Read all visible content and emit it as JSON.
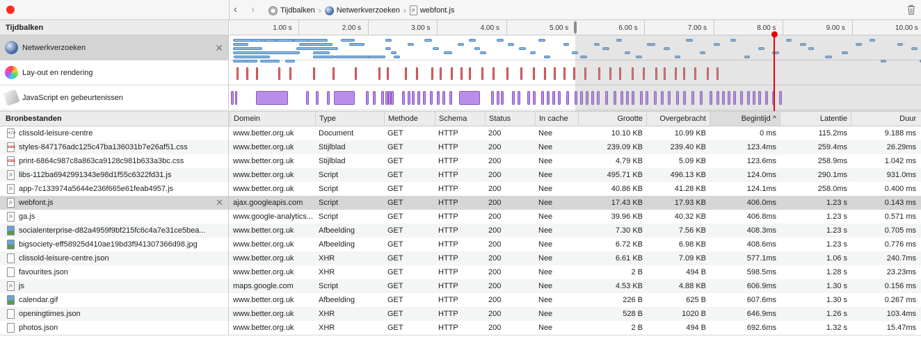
{
  "toolbar": {
    "record_icon": "record-icon",
    "back_icon": "‹",
    "forward_icon": "›",
    "breadcrumbs": [
      {
        "icon": "timelines-icon",
        "label": "Tijdbalken"
      },
      {
        "icon": "network-globe-icon",
        "label": "Netwerkverzoeken"
      },
      {
        "icon": "js-file-icon",
        "label": "webfont.js"
      }
    ],
    "trash_icon": "trash-icon"
  },
  "timelines": {
    "header": "Tijdbalken",
    "rows": [
      {
        "label": "Netwerkverzoeken",
        "icon": "network-globe-icon",
        "selected": true,
        "close": "✕"
      },
      {
        "label": "Lay-out en rendering",
        "icon": "layout-rendering-icon",
        "selected": false
      },
      {
        "label": "JavaScript en gebeurtenissen",
        "icon": "javascript-events-icon",
        "selected": false
      }
    ],
    "ruler_ticks": [
      "1.00 s",
      "2.00 s",
      "3.00 s",
      "4.00 s",
      "5.00 s",
      "6.00 s",
      "7.00 s",
      "8.00 s",
      "9.00 s",
      "10.00 s"
    ],
    "visible_range_s": [
      0,
      10.0
    ],
    "selection_s": [
      5.0,
      10.0
    ],
    "playhead_s": 7.88,
    "colors": {
      "network": "#8ab6dc",
      "layout": "#e6787a",
      "javascript": "#b98ee8",
      "playhead": "#e0000f"
    }
  },
  "table": {
    "source_header": "Bronbestanden",
    "columns": [
      "Domein",
      "Type",
      "Methode",
      "Schema",
      "Status",
      "In cache",
      "Grootte",
      "Overgebracht",
      "Begintijd",
      "Latentie",
      "Duur"
    ],
    "sorted_column": "Begintijd",
    "sort_indicator": "^",
    "row_close": "✕",
    "rows": [
      {
        "name": "clissold-leisure-centre",
        "icon": "document",
        "domain": "www.better.org.uk",
        "type": "Document",
        "method": "GET",
        "scheme": "HTTP",
        "status": "200",
        "cached": "Nee",
        "size": "10.10 KB",
        "transferred": "10.99 KB",
        "start": "0 ms",
        "latency": "115.2ms",
        "duration": "9.188 ms"
      },
      {
        "name": "styles-847176adc125c47ba136031b7e26af51.css",
        "icon": "css",
        "domain": "www.better.org.uk",
        "type": "Stijlblad",
        "method": "GET",
        "scheme": "HTTP",
        "status": "200",
        "cached": "Nee",
        "size": "239.09 KB",
        "transferred": "239.40 KB",
        "start": "123.4ms",
        "latency": "259.4ms",
        "duration": "26.29ms"
      },
      {
        "name": "print-6864c987c8a863ca9128c981b633a3bc.css",
        "icon": "css",
        "domain": "www.better.org.uk",
        "type": "Stijlblad",
        "method": "GET",
        "scheme": "HTTP",
        "status": "200",
        "cached": "Nee",
        "size": "4.79 KB",
        "transferred": "5.09 KB",
        "start": "123.6ms",
        "latency": "258.9ms",
        "duration": "1.042 ms"
      },
      {
        "name": "libs-112ba6942991343e98d1f55c6322fd31.js",
        "icon": "js",
        "domain": "www.better.org.uk",
        "type": "Script",
        "method": "GET",
        "scheme": "HTTP",
        "status": "200",
        "cached": "Nee",
        "size": "495.71 KB",
        "transferred": "496.13 KB",
        "start": "124.0ms",
        "latency": "290.1ms",
        "duration": "931.0ms"
      },
      {
        "name": "app-7c133974a5644e236f665e61feab4957.js",
        "icon": "js",
        "domain": "www.better.org.uk",
        "type": "Script",
        "method": "GET",
        "scheme": "HTTP",
        "status": "200",
        "cached": "Nee",
        "size": "40.86 KB",
        "transferred": "41.28 KB",
        "start": "124.1ms",
        "latency": "258.0ms",
        "duration": "0.400 ms"
      },
      {
        "name": "webfont.js",
        "icon": "js",
        "selected": true,
        "domain": "ajax.googleapis.com",
        "type": "Script",
        "method": "GET",
        "scheme": "HTTP",
        "status": "200",
        "cached": "Nee",
        "size": "17.43 KB",
        "transferred": "17.93 KB",
        "start": "406.0ms",
        "latency": "1.23 s",
        "duration": "0.143 ms"
      },
      {
        "name": "ga.js",
        "icon": "js",
        "domain": "www.google-analytics...",
        "type": "Script",
        "method": "GET",
        "scheme": "HTTP",
        "status": "200",
        "cached": "Nee",
        "size": "39.96 KB",
        "transferred": "40.32 KB",
        "start": "406.8ms",
        "latency": "1.23 s",
        "duration": "0.571 ms"
      },
      {
        "name": "socialenterprise-d82a4959f9bf215fc6c4a7e31ce5bea...",
        "icon": "img",
        "domain": "www.better.org.uk",
        "type": "Afbeelding",
        "method": "GET",
        "scheme": "HTTP",
        "status": "200",
        "cached": "Nee",
        "size": "7.30 KB",
        "transferred": "7.56 KB",
        "start": "408.3ms",
        "latency": "1.23 s",
        "duration": "0.705 ms"
      },
      {
        "name": "bigsociety-eff58925d410ae19bd3f941307366d98.jpg",
        "icon": "img",
        "domain": "www.better.org.uk",
        "type": "Afbeelding",
        "method": "GET",
        "scheme": "HTTP",
        "status": "200",
        "cached": "Nee",
        "size": "6.72 KB",
        "transferred": "6.98 KB",
        "start": "408.6ms",
        "latency": "1.23 s",
        "duration": "0.776 ms"
      },
      {
        "name": "clissold-leisure-centre.json",
        "icon": "blank",
        "domain": "www.better.org.uk",
        "type": "XHR",
        "method": "GET",
        "scheme": "HTTP",
        "status": "200",
        "cached": "Nee",
        "size": "6.61 KB",
        "transferred": "7.09 KB",
        "start": "577.1ms",
        "latency": "1.06 s",
        "duration": "240.7ms"
      },
      {
        "name": "favourites.json",
        "icon": "blank",
        "domain": "www.better.org.uk",
        "type": "XHR",
        "method": "GET",
        "scheme": "HTTP",
        "status": "200",
        "cached": "Nee",
        "size": "2 B",
        "transferred": "494 B",
        "start": "598.5ms",
        "latency": "1.28 s",
        "duration": "23.23ms"
      },
      {
        "name": "js",
        "icon": "js",
        "domain": "maps.google.com",
        "type": "Script",
        "method": "GET",
        "scheme": "HTTP",
        "status": "200",
        "cached": "Nee",
        "size": "4.53 KB",
        "transferred": "4.88 KB",
        "start": "606.9ms",
        "latency": "1.30 s",
        "duration": "0.156 ms"
      },
      {
        "name": "calendar.gif",
        "icon": "img",
        "domain": "www.better.org.uk",
        "type": "Afbeelding",
        "method": "GET",
        "scheme": "HTTP",
        "status": "200",
        "cached": "Nee",
        "size": "226 B",
        "transferred": "625 B",
        "start": "607.6ms",
        "latency": "1.30 s",
        "duration": "0.267 ms"
      },
      {
        "name": "openingtimes.json",
        "icon": "blank",
        "domain": "www.better.org.uk",
        "type": "XHR",
        "method": "GET",
        "scheme": "HTTP",
        "status": "200",
        "cached": "Nee",
        "size": "528 B",
        "transferred": "1020 B",
        "start": "646.9ms",
        "latency": "1.26 s",
        "duration": "103.4ms"
      },
      {
        "name": "photos.json",
        "icon": "blank",
        "domain": "www.better.org.uk",
        "type": "XHR",
        "method": "GET",
        "scheme": "HTTP",
        "status": "200",
        "cached": "Nee",
        "size": "2 B",
        "transferred": "494 B",
        "start": "692.6ms",
        "latency": "1.32 s",
        "duration": "15.47ms"
      }
    ]
  }
}
